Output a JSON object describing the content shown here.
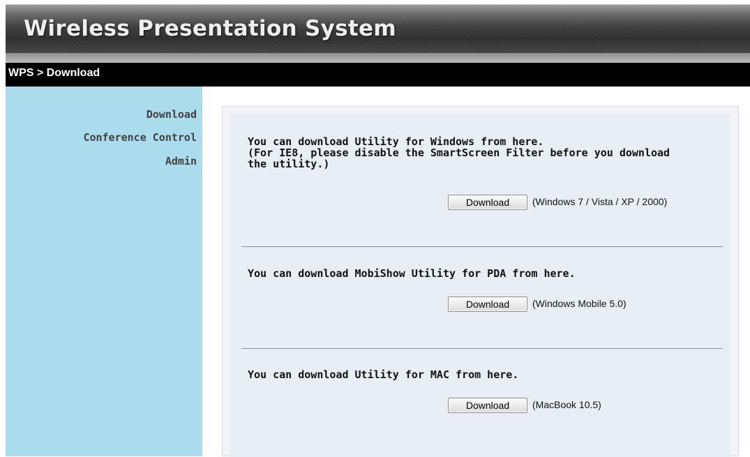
{
  "app": {
    "title": "Wireless Presentation System"
  },
  "breadcrumb": "WPS > Download",
  "sidebar": {
    "items": [
      {
        "label": "Download"
      },
      {
        "label": "Conference Control"
      },
      {
        "label": "Admin"
      }
    ]
  },
  "downloads": [
    {
      "lines": [
        "You can download Utility for Windows from here.",
        "(For IE8, please disable the SmartScreen Filter before you download",
        "the utility.)"
      ],
      "button_label": "Download",
      "requirement": "(Windows 7 / Vista / XP / 2000)"
    },
    {
      "lines": [
        "You can download MobiShow Utility for PDA from here."
      ],
      "button_label": "Download",
      "requirement": "(Windows Mobile 5.0)"
    },
    {
      "lines": [
        "You can download Utility for MAC from here."
      ],
      "button_label": "Download",
      "requirement": "(MacBook 10.5)"
    }
  ]
}
